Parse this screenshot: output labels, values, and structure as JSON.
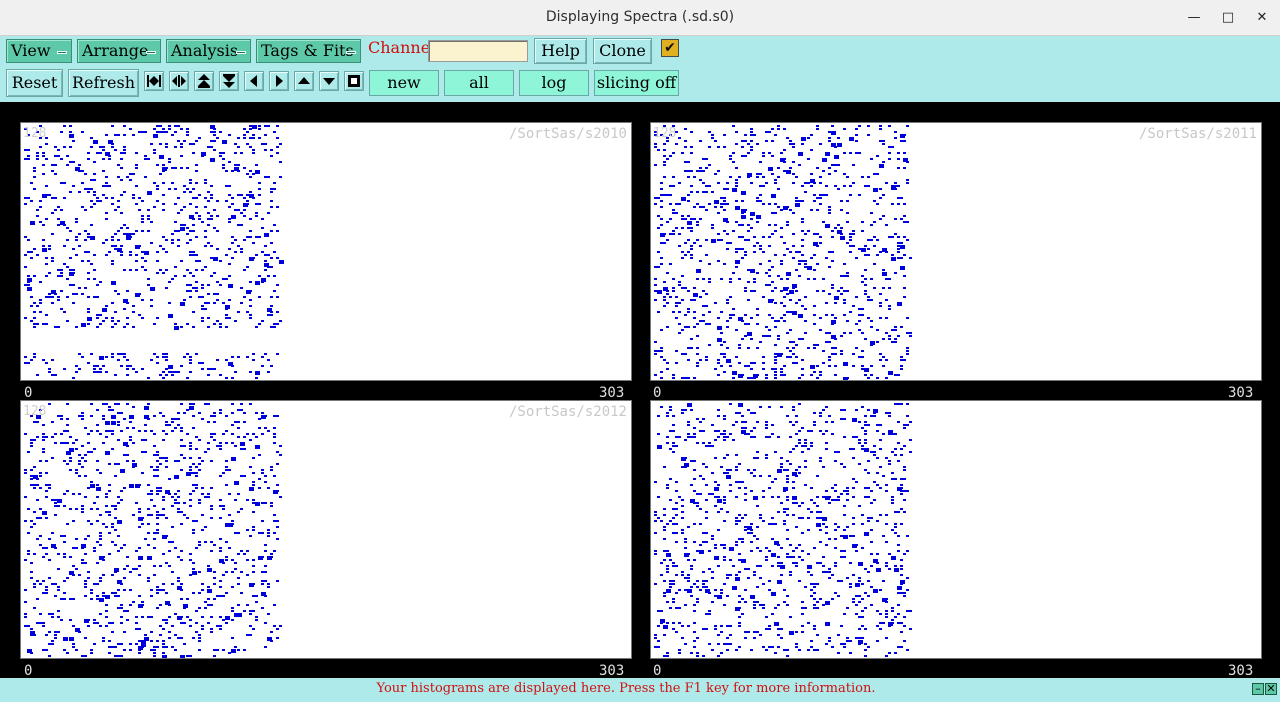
{
  "window": {
    "title": "Displaying Spectra (.sd.s0)",
    "controls": [
      "minimize-icon",
      "maximize-icon",
      "close-icon"
    ]
  },
  "menus": [
    {
      "label": "View"
    },
    {
      "label": "Arrange"
    },
    {
      "label": "Analysis"
    },
    {
      "label": "Tags & Fits"
    }
  ],
  "channel": {
    "label": "Channel:",
    "value": ""
  },
  "buttons": {
    "help": "Help",
    "clone": "Clone",
    "reset": "Reset",
    "refresh": "Refresh",
    "new": "new",
    "all": "all",
    "log": "log",
    "slicing": "slicing off"
  },
  "checkbox": {
    "checked": true,
    "icon": "check-icon"
  },
  "nav_icons": [
    "first-icon",
    "expand-horizontal-icon",
    "expand-up-icon",
    "expand-down-icon",
    "left-icon",
    "right-icon",
    "up-icon",
    "down-icon",
    "stop-icon"
  ],
  "colors": {
    "toolbar": "#aeeaea",
    "menu": "#5dc9a8",
    "green_button": "#8ef5d8",
    "data": "#0000dd",
    "status_text": "#d01010"
  },
  "panes": [
    {
      "name": "/SortSas/s2010",
      "ymax": "128",
      "xmin": "0",
      "xmax": "303"
    },
    {
      "name": "/SortSas/s2011",
      "ymax": "128",
      "xmin": "0",
      "xmax": "303"
    },
    {
      "name": "/SortSas/s2012",
      "ymax": "128",
      "xmin": "0",
      "xmax": "303"
    },
    {
      "name": "",
      "ymax": "",
      "xmin": "0",
      "xmax": "303"
    }
  ],
  "status": {
    "message": "Your histograms are displayed here. Press the F1 key for more information."
  }
}
